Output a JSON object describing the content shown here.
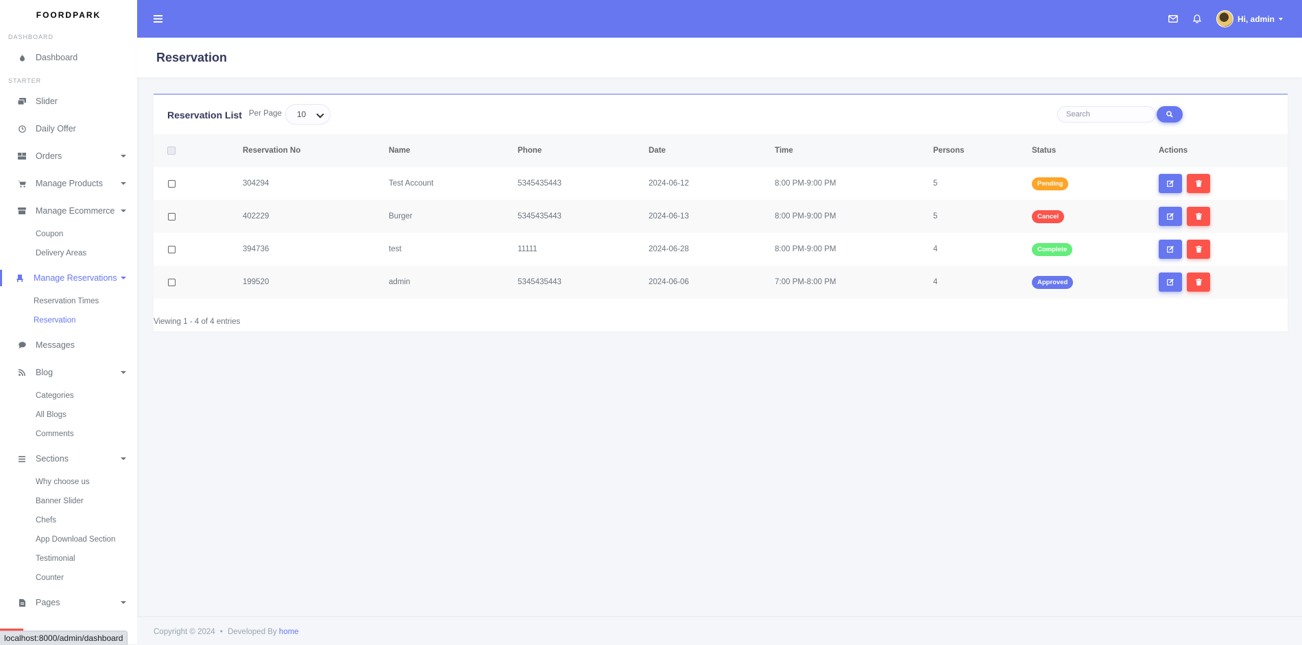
{
  "brand": "FOORDPARK",
  "sidebar": {
    "header_dashboard": "DASHBOARD",
    "dashboard": "Dashboard",
    "header_starter": "STARTER",
    "slider": "Slider",
    "daily_offer": "Daily Offer",
    "orders": "Orders",
    "manage_products": "Manage Products",
    "manage_ecommerce": "Manage Ecommerce",
    "coupon": "Coupon",
    "delivery_areas": "Delivery Areas",
    "manage_reservations": "Manage Reservations",
    "reservation_times": "Reservation Times",
    "reservation": "Reservation",
    "messages": "Messages",
    "blog": "Blog",
    "categories": "Categories",
    "all_blogs": "All Blogs",
    "comments": "Comments",
    "sections": "Sections",
    "why_choose_us": "Why choose us",
    "banner_slider": "Banner Slider",
    "chefs": "Chefs",
    "app_download_section": "App Download Section",
    "testimonial": "Testimonial",
    "counter": "Counter",
    "pages": "Pages"
  },
  "topbar": {
    "user_greeting": "Hi, admin"
  },
  "page": {
    "title": "Reservation"
  },
  "card": {
    "title": "Reservation List",
    "per_page_label": "Per Page",
    "per_page_value": "10",
    "search_placeholder": "Search",
    "viewing": "Viewing 1 - 4 of 4 entries"
  },
  "table": {
    "headers": {
      "reservation_no": "Reservation No",
      "name": "Name",
      "phone": "Phone",
      "date": "Date",
      "time": "Time",
      "persons": "Persons",
      "status": "Status",
      "actions": "Actions"
    },
    "rows": [
      {
        "reservation_no": "304294",
        "name": "Test Account",
        "phone": "5345435443",
        "date": "2024-06-12",
        "time": "8:00 PM-9:00 PM",
        "persons": "5",
        "status": "Pending",
        "status_color": "#ffa426"
      },
      {
        "reservation_no": "402229",
        "name": "Burger",
        "phone": "5345435443",
        "date": "2024-06-13",
        "time": "8:00 PM-9:00 PM",
        "persons": "5",
        "status": "Cancel",
        "status_color": "#fc544b"
      },
      {
        "reservation_no": "394736",
        "name": "test",
        "phone": "11111",
        "date": "2024-06-28",
        "time": "8:00 PM-9:00 PM",
        "persons": "4",
        "status": "Complete",
        "status_color": "#63ed7a"
      },
      {
        "reservation_no": "199520",
        "name": "admin",
        "phone": "5345435443",
        "date": "2024-06-06",
        "time": "7:00 PM-8:00 PM",
        "persons": "4",
        "status": "Approved",
        "status_color": "#6777ef"
      }
    ]
  },
  "footer": {
    "copyright": "Copyright © 2024",
    "bullet": "•",
    "developed_by": "Developed By",
    "link": "home"
  },
  "statusbar": {
    "url": "localhost:8000/admin/dashboard"
  },
  "colors": {
    "primary": "#6777ef",
    "danger": "#fc544b",
    "warning": "#ffa426",
    "success": "#63ed7a"
  },
  "icons": {
    "dashboard": "fire-icon",
    "slider": "images-icon",
    "daily_offer": "clock-icon",
    "orders": "box-icon",
    "manage_products": "cart-icon",
    "manage_ecommerce": "store-icon",
    "manage_reservations": "chair-icon",
    "messages": "comment-icon",
    "blog": "rss-icon",
    "sections": "bars-icon",
    "pages": "file-icon"
  }
}
